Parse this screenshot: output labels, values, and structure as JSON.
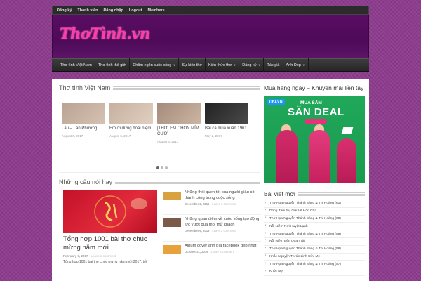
{
  "topbar": [
    "Đăng ký",
    "Thành viên",
    "Đăng nhập",
    "Logout",
    "Members"
  ],
  "logo": "ThơTình.vn",
  "nav": [
    {
      "label": "Thơ tình Việt Nam",
      "caret": false
    },
    {
      "label": "Thơ tình thế giới",
      "caret": false
    },
    {
      "label": "Châm ngôn cuộc sống",
      "caret": true
    },
    {
      "label": "Sự kiện thơ",
      "caret": false
    },
    {
      "label": "Kiến thức thơ",
      "caret": true
    },
    {
      "label": "Đăng ký",
      "caret": true
    },
    {
      "label": "Tác giả",
      "caret": false
    },
    {
      "label": "Ảnh Đẹp",
      "caret": true
    }
  ],
  "main": {
    "section1": "Thơ tình Việt Nam",
    "slides": [
      {
        "title": "Lâu – Lan Phương",
        "date": "August 6, 2017",
        "color1": "#b9a293",
        "color2": "#d6c2b2"
      },
      {
        "title": "Em ơi đừng hoài niệm",
        "date": "August 6, 2017",
        "color1": "#c6b09f",
        "color2": "#e0cfc0"
      },
      {
        "title": "[THƠ] EM CHỌN MỈM CƯỜI",
        "date": "August 6, 2017",
        "color1": "#a38a7a",
        "color2": "#cdb5a3"
      },
      {
        "title": "Bài ca mùa xuân 1961",
        "date": "May 2, 2017",
        "color1": "#222222",
        "color2": "#4a4a4a"
      }
    ],
    "section2": "Những câu nói hay",
    "featured": {
      "title": "Tổng hợp 1001 bài thơ chúc mừng năm mới",
      "date": "February 6, 2017",
      "comment": "Leave a comment",
      "excerpt": "Tổng hợp 1001 bài thơ chúc mừng năm mới 2017, tết"
    },
    "quotes": [
      {
        "title": "Những thói quen tốt của người giàu có thành công trong cuộc sống",
        "date": "December 6, 2016",
        "comment": "Leave a comment",
        "color": "#d9a23f"
      },
      {
        "title": "Những quan điểm về cuộc sống tạo động lực vượt qua mọi thử khách",
        "date": "December 6, 2016",
        "comment": "Leave a comment",
        "color": "#7b5a4a"
      },
      {
        "title": "Album cover ảnh bìa facebook đẹp nhất",
        "date": "October 21, 2016",
        "comment": "Leave a comment",
        "color": "#e8a23c"
      }
    ]
  },
  "sidebar": {
    "promo_title": "Mua hàng ngay – Khuyến mãi liền tay",
    "banner": {
      "brand": "TIKI.VN",
      "line1": "MUA SẮM",
      "line2": "SĂN DEAL"
    },
    "recent_title": "Bài viết mới",
    "recent": [
      "Thơ Họa Nguyễn Thánh Sáng & Thi Hoàng (61)",
      "Dòng Tâm Sự Gửi Về Hồn Cha",
      "Thơ Họa Nguyễn Thánh Sáng & Thi Hoàng (60)",
      "Nỗi Niềm Nơi Huyệt Lạnh",
      "Thơ Họa Nguyễn Thánh Sáng & Thi Hoàng (59)",
      "Nỗi Niềm Bên Quan Tài",
      "Thơ Họa Nguyễn Thánh Sáng & Thi Hoàng (58)",
      "Khắc Nguyện Trước Linh Cữu Mẹ",
      "Thơ Họa Nguyễn Thánh Sáng & Thi Hoàng (57)",
      "Khóc Mẹ"
    ]
  }
}
